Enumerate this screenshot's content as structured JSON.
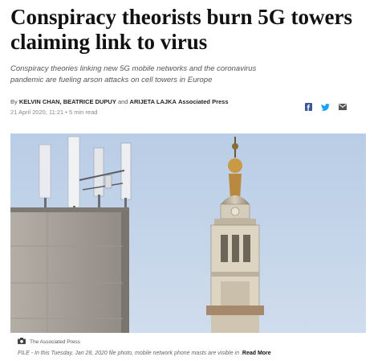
{
  "article": {
    "headline_line1": "Conspiracy theorists burn 5G towers",
    "headline_line2": "claiming link to virus",
    "subhead_line1": "Conspiracy theories linking new 5G mobile networks and the coronavirus",
    "subhead_line2": "pandemic are fueling arson attacks on cell towers in Europe",
    "byline": {
      "prefix": "By",
      "authors": "KELVIN CHAN, BEATRICE DUPUY",
      "conjunction": "and",
      "last_author": "ARIJETA LAJKA",
      "agency": "Associated Press"
    },
    "date": "21 April 2020, 11:21",
    "read_time": "5 min read",
    "separator": "•"
  },
  "share": {
    "icons": [
      "facebook-icon",
      "twitter-icon",
      "email-icon"
    ],
    "colors": {
      "facebook": "#3b5998",
      "twitter": "#1da1f2",
      "email": "#555555"
    }
  },
  "photo": {
    "credit": "The Associated Press",
    "caption": "FILE - In this Tuesday, Jan 28, 2020 file photo, mobile network phone masts are visible in .",
    "read_more": "Read More"
  }
}
